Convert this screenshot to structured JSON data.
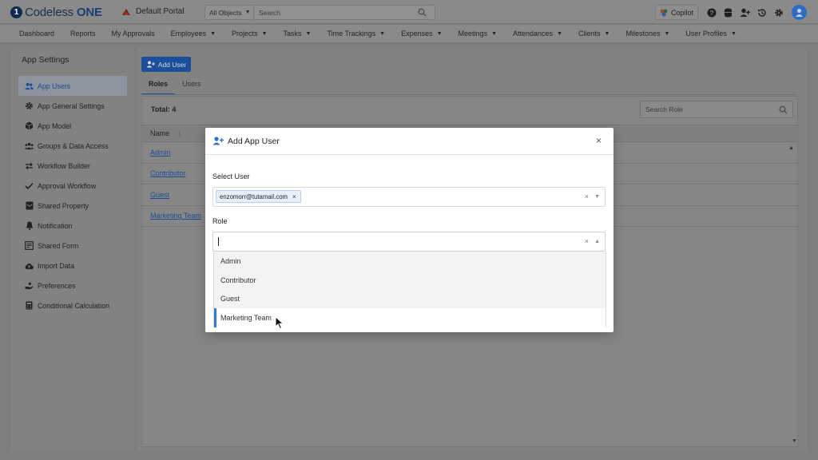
{
  "header": {
    "logo_mark": "1",
    "logo_text": "Codeless ",
    "logo_text_bold": "ONE",
    "portal_name": "Default Portal",
    "objects_select": "All Objects",
    "search_placeholder": "Search",
    "copilot_label": "Copilot"
  },
  "nav": {
    "items": [
      "Dashboard",
      "Reports",
      "My Approvals",
      "Employees",
      "Projects",
      "Tasks",
      "Time Trackings",
      "Expenses",
      "Meetings",
      "Attendances",
      "Clients",
      "Milestones",
      "User Profiles"
    ]
  },
  "sidebar": {
    "title": "App Settings",
    "items": [
      {
        "label": "App Users",
        "icon": "users-icon"
      },
      {
        "label": "App General Settings",
        "icon": "gear-icon"
      },
      {
        "label": "App Model",
        "icon": "cube-icon"
      },
      {
        "label": "Groups & Data Access",
        "icon": "group-icon"
      },
      {
        "label": "Workflow Builder",
        "icon": "swap-arrows-icon"
      },
      {
        "label": "Approval Workflow",
        "icon": "check-icon"
      },
      {
        "label": "Shared Property",
        "icon": "property-icon"
      },
      {
        "label": "Notification",
        "icon": "bell-icon"
      },
      {
        "label": "Shared Form",
        "icon": "form-icon"
      },
      {
        "label": "Import Data",
        "icon": "cloud-upload-icon"
      },
      {
        "label": "Preferences",
        "icon": "hand-icon"
      },
      {
        "label": "Conditional Calculation",
        "icon": "calculator-icon"
      }
    ]
  },
  "main": {
    "add_user_label": "Add User",
    "tabs": [
      "Roles",
      "Users"
    ],
    "total_label": "Total: 4",
    "search_role_placeholder": "Search Role",
    "column_name": "Name",
    "rows": [
      "Admin",
      "Contributor",
      "Guest",
      "Marketing Team"
    ]
  },
  "modal": {
    "title": "Add App User",
    "select_user_label": "Select User",
    "selected_user": "enzomorr@tutamail.com",
    "role_label": "Role",
    "role_options": [
      "Admin",
      "Contributor",
      "Guest",
      "Marketing Team"
    ]
  },
  "colors": {
    "accent": "#2e7ad4",
    "button": "#1b4f99",
    "overlay": "#7e7e7e"
  }
}
